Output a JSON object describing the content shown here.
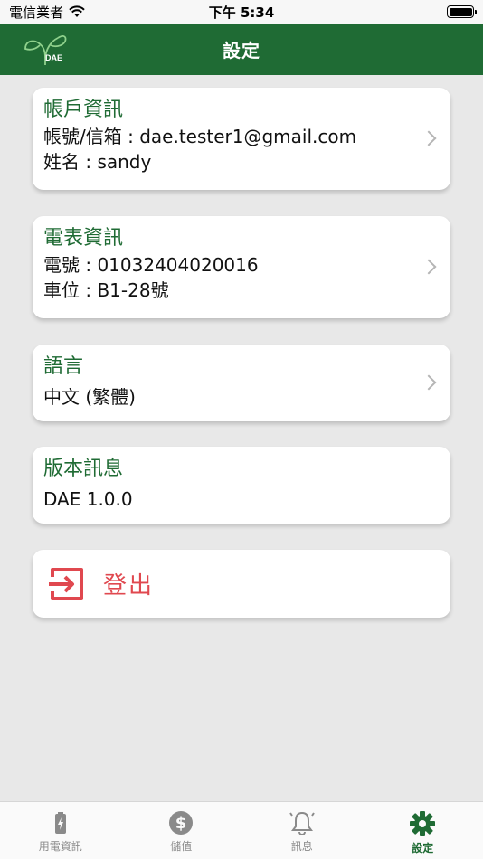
{
  "status_bar": {
    "carrier": "電信業者",
    "time": "下午 5:34"
  },
  "header": {
    "title": "設定",
    "logo_text": "DAE"
  },
  "account": {
    "title": "帳戶資訊",
    "email_label": "帳號/信箱",
    "email": "dae.tester1@gmail.com",
    "name_label": "姓名",
    "name": "sandy"
  },
  "meter": {
    "title": "電表資訊",
    "number_label": "電號",
    "number": "01032404020016",
    "slot_label": "車位",
    "slot": "B1-28號"
  },
  "language": {
    "title": "語言",
    "value": "中文 (繁體)"
  },
  "version": {
    "title": "版本訊息",
    "value": "DAE 1.0.0"
  },
  "logout": {
    "label": "登出"
  },
  "tabs": [
    {
      "label": "用電資訊",
      "icon": "battery-charging-icon",
      "active": false
    },
    {
      "label": "儲值",
      "icon": "dollar-coin-icon",
      "active": false
    },
    {
      "label": "訊息",
      "icon": "bell-icon",
      "active": false
    },
    {
      "label": "設定",
      "icon": "gear-icon",
      "active": true
    }
  ],
  "colors": {
    "primary": "#1f6b34",
    "danger": "#e0484f",
    "inactive": "#8a8a8a"
  }
}
